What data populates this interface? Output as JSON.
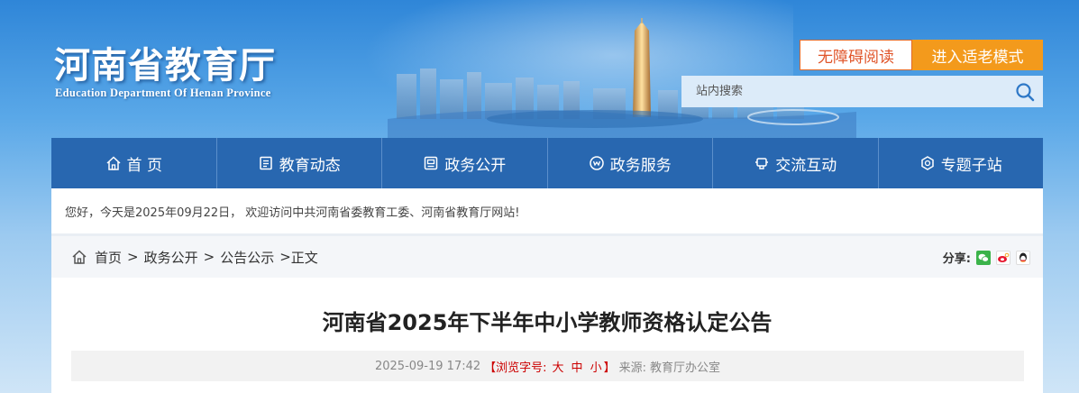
{
  "header": {
    "site_title": "河南省教育厅",
    "site_title_en": "Education Department Of Henan Province",
    "accessibility_label": "无障碍阅读",
    "elder_mode_label": "进入适老模式",
    "search_placeholder": "站内搜索"
  },
  "nav": {
    "items": [
      {
        "label": "首 页",
        "icon": "home-icon"
      },
      {
        "label": "教育动态",
        "icon": "news-icon"
      },
      {
        "label": "政务公开",
        "icon": "gov-icon"
      },
      {
        "label": "政务服务",
        "icon": "service-icon"
      },
      {
        "label": "交流互动",
        "icon": "interact-icon"
      },
      {
        "label": "专题子站",
        "icon": "topic-icon"
      }
    ]
  },
  "welcome": {
    "text": "您好，今天是2025年09月22日， 欢迎访问中共河南省委教育工委、河南省教育厅网站!"
  },
  "breadcrumb": {
    "items": [
      "首页",
      "政务公开",
      "公告公示",
      "正文"
    ],
    "separator": ">"
  },
  "share": {
    "label": "分享:",
    "targets": [
      "wechat-icon",
      "weibo-icon",
      "qq-icon"
    ]
  },
  "article": {
    "title": "河南省2025年下半年中小学教师资格认定公告",
    "date": "2025-09-19 17:42",
    "font_size_prefix": "【浏览字号:",
    "font_sizes": [
      "大",
      "中",
      "小"
    ],
    "font_size_suffix": "】",
    "source_label": "来源:",
    "source": "教育厅办公室"
  },
  "colors": {
    "nav_bg": "#2867b0",
    "elder_btn": "#f39a1c",
    "accessibility_border": "#e06a2a"
  }
}
